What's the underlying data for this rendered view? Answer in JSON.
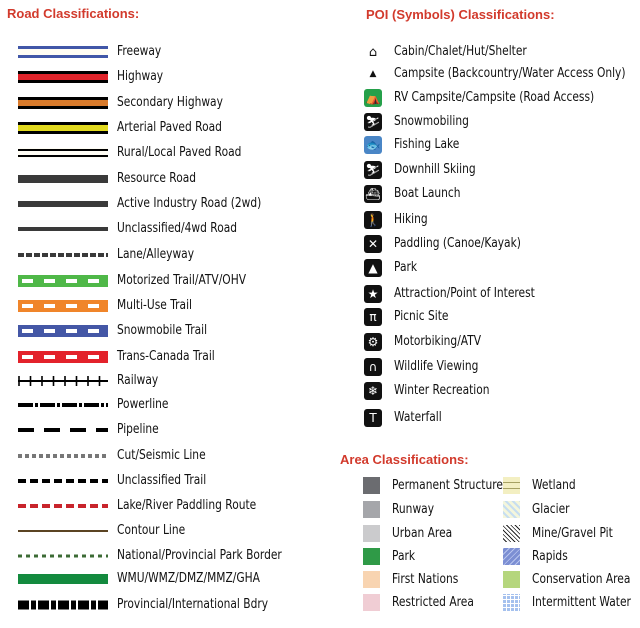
{
  "road": {
    "title": "Road Classifications:",
    "items": [
      {
        "label": "Freeway",
        "style": "freeway",
        "colors": [
          "#4157a8",
          "#fffdf4"
        ]
      },
      {
        "label": "Highway",
        "style": "cased",
        "colors": [
          "#000000",
          "#e0232a"
        ]
      },
      {
        "label": "Secondary Highway",
        "style": "cased",
        "colors": [
          "#000000",
          "#d97b2c"
        ]
      },
      {
        "label": "Arterial Paved Road",
        "style": "cased",
        "colors": [
          "#000000",
          "#e1d91f"
        ]
      },
      {
        "label": "Rural/Local Paved Road",
        "style": "rural",
        "colors": [
          "#000000",
          "#fffdf4"
        ]
      },
      {
        "label": "Resource Road",
        "style": "solid-thick",
        "colors": [
          "#3a3a3a"
        ]
      },
      {
        "label": "Active Industry Road (2wd)",
        "style": "solid-medium",
        "colors": [
          "#3a3a3a"
        ]
      },
      {
        "label": "Unclassified/4wd Road",
        "style": "solid-thin",
        "colors": [
          "#3a3a3a"
        ]
      },
      {
        "label": "Lane/Alleyway",
        "style": "dash-small",
        "colors": [
          "#3a3a3a"
        ]
      },
      {
        "label": "Motorized Trail/ATV/OHV",
        "style": "trail",
        "colors": [
          "#4fb848",
          "#ffffff"
        ]
      },
      {
        "label": "Multi-Use Trail",
        "style": "trail",
        "colors": [
          "#f0852a",
          "#ffffff"
        ]
      },
      {
        "label": "Snowmobile Trail",
        "style": "trail",
        "colors": [
          "#4457a6",
          "#ffffff"
        ]
      },
      {
        "label": "Trans-Canada Trail",
        "style": "trail",
        "colors": [
          "#e3222b",
          "#ffffff"
        ]
      },
      {
        "label": "Railway",
        "style": "railway",
        "colors": [
          "#000000"
        ]
      },
      {
        "label": "Powerline",
        "style": "dashdot",
        "colors": [
          "#000000"
        ]
      },
      {
        "label": "Pipeline",
        "style": "dash-long",
        "colors": [
          "#000000"
        ]
      },
      {
        "label": "Cut/Seismic Line",
        "style": "dot-grey",
        "colors": [
          "#777777"
        ]
      },
      {
        "label": "Unclassified Trail",
        "style": "dash-black",
        "colors": [
          "#000000"
        ]
      },
      {
        "label": "Lake/River Paddling Route",
        "style": "dash-red",
        "colors": [
          "#c8242b"
        ]
      },
      {
        "label": "Contour Line",
        "style": "thin-line",
        "colors": [
          "#5b4423"
        ]
      },
      {
        "label": "National/Provincial Park Border",
        "style": "dash-green",
        "colors": [
          "#3c6b35"
        ]
      },
      {
        "label": "WMU/WMZ/DMZ/MMZ/GHA",
        "style": "band",
        "colors": [
          "#138a3e"
        ]
      },
      {
        "label": "Provincial/International Bdry",
        "style": "blocks",
        "colors": [
          "#000000"
        ]
      }
    ]
  },
  "poi": {
    "title": "POI (Symbols) Classifications:",
    "items": [
      {
        "label": "Cabin/Chalet/Hut/Shelter",
        "icon": "cabin-icon",
        "glyph": "⌂",
        "bg": "none"
      },
      {
        "label": "Campsite (Backcountry/Water Access Only)",
        "icon": "tent-icon",
        "glyph": "▲",
        "bg": "none"
      },
      {
        "label": "RV Campsite/Campsite (Road Access)",
        "icon": "rv-campsite-icon",
        "glyph": "⛺",
        "bg": "#25a04a"
      },
      {
        "label": "Snowmobiling",
        "icon": "snowmobile-icon",
        "glyph": "⛷",
        "bg": "#111111"
      },
      {
        "label": "Fishing Lake",
        "icon": "fish-icon",
        "glyph": "🐟",
        "bg": "#4a86c6"
      },
      {
        "label": "Downhill Skiing",
        "icon": "skiing-icon",
        "glyph": "⛷",
        "bg": "#111111"
      },
      {
        "label": "Boat Launch",
        "icon": "boat-launch-icon",
        "glyph": "⛴",
        "bg": "#111111"
      },
      {
        "label": "Hiking",
        "icon": "hiking-icon",
        "glyph": "🚶",
        "bg": "#111111"
      },
      {
        "label": "Paddling (Canoe/Kayak)",
        "icon": "paddling-icon",
        "glyph": "✕",
        "bg": "#111111"
      },
      {
        "label": "Park",
        "icon": "park-icon",
        "glyph": "▲",
        "bg": "#111111"
      },
      {
        "label": "Attraction/Point of Interest",
        "icon": "star-icon",
        "glyph": "★",
        "bg": "#111111"
      },
      {
        "label": "Picnic Site",
        "icon": "picnic-icon",
        "glyph": "π",
        "bg": "#111111"
      },
      {
        "label": "Motorbiking/ATV",
        "icon": "atv-icon",
        "glyph": "⚙",
        "bg": "#111111"
      },
      {
        "label": "Wildlife Viewing",
        "icon": "binoculars-icon",
        "glyph": "∩",
        "bg": "#111111"
      },
      {
        "label": "Winter Recreation",
        "icon": "snowflake-icon",
        "glyph": "❄",
        "bg": "#111111"
      },
      {
        "label": "Waterfall",
        "icon": "waterfall-icon",
        "glyph": "T",
        "bg": "#111111"
      }
    ]
  },
  "area": {
    "title": "Area Classifications:",
    "left": [
      {
        "label": "Permanent Structure",
        "color": "#6b6c70",
        "pattern": "solid"
      },
      {
        "label": "Runway",
        "color": "#a5a6aa",
        "pattern": "solid"
      },
      {
        "label": "Urban Area",
        "color": "#cbcbcd",
        "pattern": "solid"
      },
      {
        "label": "Park",
        "color": "#2f9a47",
        "pattern": "solid"
      },
      {
        "label": "First Nations",
        "color": "#f8d4b1",
        "pattern": "solid"
      },
      {
        "label": "Restricted Area",
        "color": "#f0cdd4",
        "pattern": "solid"
      }
    ],
    "right": [
      {
        "label": "Wetland",
        "color": "#f3efc2",
        "pattern": "wetland"
      },
      {
        "label": "Glacier",
        "color": "#f4f6dc",
        "pattern": "glacier"
      },
      {
        "label": "Mine/Gravel Pit",
        "color": "#ffffff",
        "pattern": "mine"
      },
      {
        "label": "Rapids",
        "color": "#7c8fd3",
        "pattern": "rapids"
      },
      {
        "label": "Conservation Area",
        "color": "#b5d67d",
        "pattern": "solid"
      },
      {
        "label": "Intermittent Water",
        "color": "#a5c1ee",
        "pattern": "grid"
      }
    ]
  }
}
